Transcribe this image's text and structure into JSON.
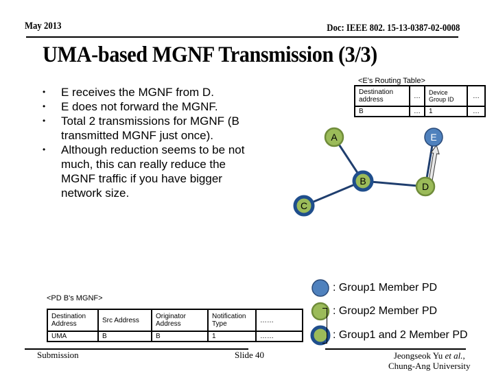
{
  "header": {
    "date": "May 2013",
    "doc_id": "Doc: IEEE 802. 15-13-0387-02-0008"
  },
  "title": "UMA-based MGNF Transmission (3/3)",
  "bullets": [
    "E receives the MGNF from D.",
    "E does not forward the MGNF.",
    "Total 2 transmissions for MGNF (B transmitted MGNF just once).",
    "Although reduction seems to be not much, this can really reduce the MGNF traffic if you have bigger network size."
  ],
  "routing_table": {
    "caption": "<E's Routing Table>",
    "header": [
      "Destination address",
      "…",
      "Device Group ID",
      "…"
    ],
    "rows": [
      [
        "B",
        "…",
        "1",
        "…"
      ]
    ]
  },
  "network": {
    "nodes": [
      {
        "id": "A",
        "label": "A",
        "type": "group2"
      },
      {
        "id": "B",
        "label": "B",
        "type": "group1and2"
      },
      {
        "id": "C",
        "label": "C",
        "type": "group1and2"
      },
      {
        "id": "D",
        "label": "D",
        "type": "group2"
      },
      {
        "id": "E",
        "label": "E",
        "type": "group1"
      }
    ],
    "links": [
      [
        "A",
        "B"
      ],
      [
        "B",
        "C"
      ],
      [
        "B",
        "D"
      ],
      [
        "D",
        "E"
      ]
    ],
    "arrows": [
      {
        "from": "D",
        "to": "E"
      }
    ]
  },
  "colors": {
    "group1_fill": "#4f81bd",
    "group1_stroke": "#2a4a78",
    "group2_fill": "#9bbb59",
    "group2_stroke": "#6f8c3a",
    "dark_ring": "#1f4e8c",
    "link": "#1f3e6e"
  },
  "legend": [
    {
      "type": "group1",
      "label": ": Group1 Member PD"
    },
    {
      "type": "group2",
      "label": ": Group2 Member PD"
    },
    {
      "type": "group1and2",
      "label": ": Group1 and 2 Member PD"
    }
  ],
  "mgnf_table": {
    "caption": "<PD B's MGNF>",
    "header": [
      "Destination Address",
      "Src Address",
      "Originator Address",
      "Notification Type",
      "……"
    ],
    "rows": [
      [
        "UMA",
        "B",
        "B",
        "1",
        "……"
      ]
    ]
  },
  "footer": {
    "submission": "Submission",
    "slide": "Slide 40",
    "author_line1": "Jeongseok Yu ",
    "author_etal": "et al.",
    "author_line1_end": ",",
    "author_line2": "Chung-Ang University"
  }
}
